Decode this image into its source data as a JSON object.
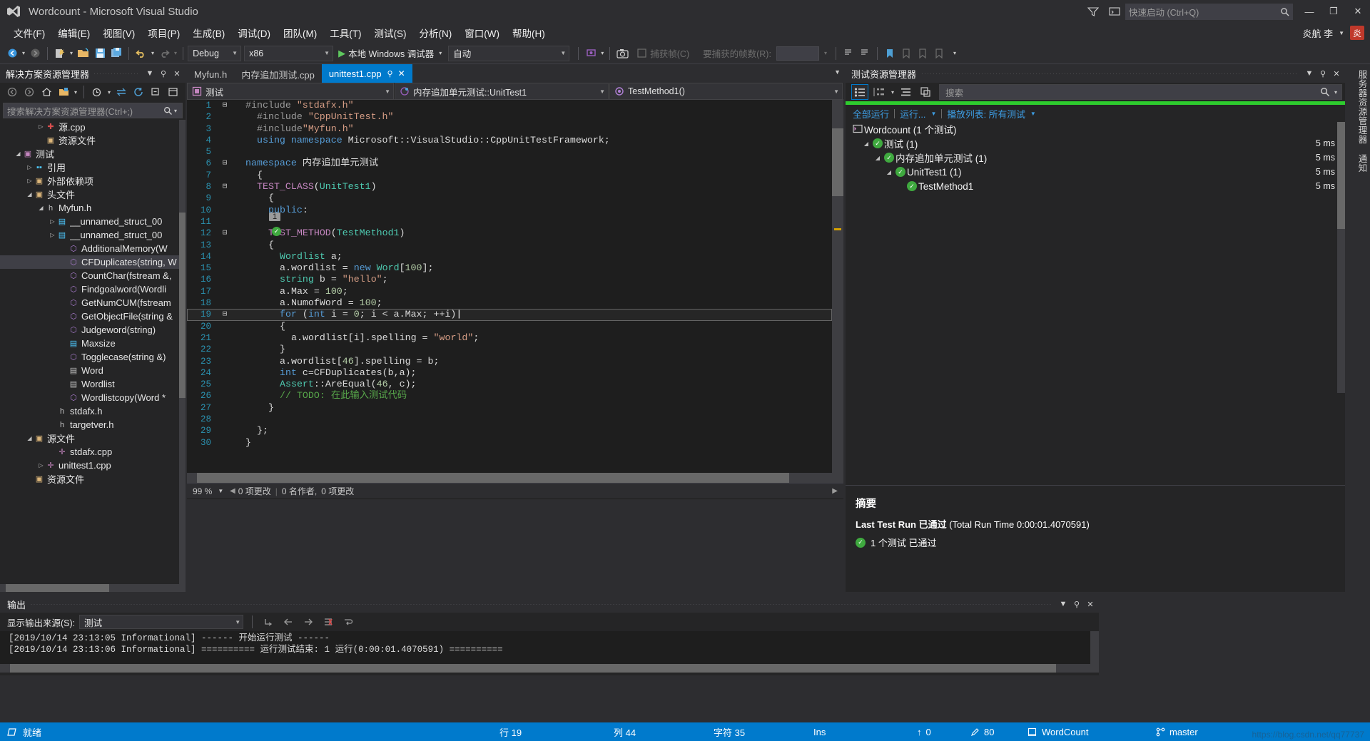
{
  "titlebar": {
    "title": "Wordcount - Microsoft Visual Studio",
    "quick_launch_placeholder": "快速启动 (Ctrl+Q)",
    "minimize": "—",
    "maximize": "❐",
    "close": "✕"
  },
  "menubar": {
    "items": [
      "文件(F)",
      "编辑(E)",
      "视图(V)",
      "项目(P)",
      "生成(B)",
      "调试(D)",
      "团队(M)",
      "工具(T)",
      "测试(S)",
      "分析(N)",
      "窗口(W)",
      "帮助(H)"
    ],
    "user_name": "炎航 李",
    "user_initial": "炎"
  },
  "toolbar": {
    "config": "Debug",
    "platform": "x86",
    "run_target": "本地 Windows 调试器",
    "auto": "自动",
    "capture_frame": "捕获帧(C)",
    "frames_label": "要捕获的帧数(R):",
    "frames_value": ""
  },
  "solution_explorer": {
    "title": "解决方案资源管理器",
    "search_placeholder": "搜索解决方案资源管理器(Ctrl+;)",
    "items": [
      {
        "label": "源.cpp",
        "indent": 3,
        "arrow": "▷",
        "icon": "cpp-error-icon",
        "color": "#d94f4f",
        "glyph": "✚"
      },
      {
        "label": "资源文件",
        "indent": 3,
        "arrow": "",
        "icon": "folder-icon",
        "color": "#dcb67a",
        "glyph": "▣"
      },
      {
        "label": "测试",
        "indent": 1,
        "arrow": "◢",
        "icon": "project-icon",
        "color": "#c586c0",
        "glyph": "▣"
      },
      {
        "label": "引用",
        "indent": 2,
        "arrow": "▷",
        "icon": "references-icon",
        "color": "#4ec9ff",
        "glyph": "▪▪"
      },
      {
        "label": "外部依赖项",
        "indent": 2,
        "arrow": "▷",
        "icon": "folder-icon",
        "color": "#dcb67a",
        "glyph": "▣"
      },
      {
        "label": "头文件",
        "indent": 2,
        "arrow": "◢",
        "icon": "folder-icon",
        "color": "#dcb67a",
        "glyph": "▣"
      },
      {
        "label": "Myfun.h",
        "indent": 3,
        "arrow": "◢",
        "icon": "header-file-icon",
        "color": "#c0c0c0",
        "glyph": "h"
      },
      {
        "label": "__unnamed_struct_00",
        "indent": 4,
        "arrow": "▷",
        "icon": "struct-icon",
        "color": "#4ec9ff",
        "glyph": "▤"
      },
      {
        "label": "__unnamed_struct_00",
        "indent": 4,
        "arrow": "▷",
        "icon": "struct-icon",
        "color": "#4ec9ff",
        "glyph": "▤"
      },
      {
        "label": "AdditionalMemory(W",
        "indent": 5,
        "arrow": "",
        "icon": "method-icon",
        "color": "#b180d7",
        "glyph": "⬡"
      },
      {
        "label": "CFDuplicates(string, W",
        "indent": 5,
        "arrow": "",
        "icon": "method-icon",
        "color": "#b180d7",
        "glyph": "⬡",
        "selected": true
      },
      {
        "label": "CountChar(fstream &,",
        "indent": 5,
        "arrow": "",
        "icon": "method-icon",
        "color": "#b180d7",
        "glyph": "⬡"
      },
      {
        "label": "Findgoalword(Wordli",
        "indent": 5,
        "arrow": "",
        "icon": "method-icon",
        "color": "#b180d7",
        "glyph": "⬡"
      },
      {
        "label": "GetNumCUM(fstream",
        "indent": 5,
        "arrow": "",
        "icon": "method-icon",
        "color": "#b180d7",
        "glyph": "⬡"
      },
      {
        "label": "GetObjectFile(string &",
        "indent": 5,
        "arrow": "",
        "icon": "method-icon",
        "color": "#b180d7",
        "glyph": "⬡"
      },
      {
        "label": "Judgeword(string)",
        "indent": 5,
        "arrow": "",
        "icon": "method-icon",
        "color": "#b180d7",
        "glyph": "⬡"
      },
      {
        "label": "Maxsize",
        "indent": 5,
        "arrow": "",
        "icon": "constant-icon",
        "color": "#4ec9ff",
        "glyph": "▤"
      },
      {
        "label": "Togglecase(string &)",
        "indent": 5,
        "arrow": "",
        "icon": "method-icon",
        "color": "#b180d7",
        "glyph": "⬡"
      },
      {
        "label": "Word",
        "indent": 5,
        "arrow": "",
        "icon": "class-icon",
        "color": "#c0c0c0",
        "glyph": "▤"
      },
      {
        "label": "Wordlist",
        "indent": 5,
        "arrow": "",
        "icon": "class-icon",
        "color": "#c0c0c0",
        "glyph": "▤"
      },
      {
        "label": "Wordlistcopy(Word *",
        "indent": 5,
        "arrow": "",
        "icon": "method-icon",
        "color": "#b180d7",
        "glyph": "⬡"
      },
      {
        "label": "stdafx.h",
        "indent": 4,
        "arrow": "",
        "icon": "header-file-icon",
        "color": "#c0c0c0",
        "glyph": "h"
      },
      {
        "label": "targetver.h",
        "indent": 4,
        "arrow": "",
        "icon": "header-file-icon",
        "color": "#c0c0c0",
        "glyph": "h"
      },
      {
        "label": "源文件",
        "indent": 2,
        "arrow": "◢",
        "icon": "folder-icon",
        "color": "#dcb67a",
        "glyph": "▣"
      },
      {
        "label": "stdafx.cpp",
        "indent": 4,
        "arrow": "",
        "icon": "cpp-file-icon",
        "color": "#c586c0",
        "glyph": "✛"
      },
      {
        "label": "unittest1.cpp",
        "indent": 3,
        "arrow": "▷",
        "icon": "cpp-file-icon",
        "color": "#c586c0",
        "glyph": "✛"
      },
      {
        "label": "资源文件",
        "indent": 2,
        "arrow": "",
        "icon": "folder-icon",
        "color": "#dcb67a",
        "glyph": "▣"
      }
    ]
  },
  "editor": {
    "tabs": [
      {
        "label": "Myfun.h",
        "active": false
      },
      {
        "label": "内存追加测试.cpp",
        "active": false
      },
      {
        "label": "unittest1.cpp",
        "active": true,
        "pin": "⚲",
        "close": "✕"
      }
    ],
    "nav": {
      "project": "测试",
      "scope": "内存追加单元测试::UnitTest1",
      "member": "TestMethod1()"
    },
    "code_coverage_badge": "1",
    "zoom": "99 %",
    "status_changes": "0 项更改",
    "status_authors": "0 名作者,",
    "status_changes2": "0 项更改",
    "lines": [
      {
        "num": 1,
        "fold": "⊟",
        "text": "#include \"stdafx.h\"",
        "tokens": [
          [
            "pp",
            "#include "
          ],
          [
            "s",
            "\"stdafx.h\""
          ]
        ]
      },
      {
        "num": 2,
        "fold": "",
        "text": "#include \"CppUnitTest.h\"",
        "tokens": [
          [
            "pp",
            "#include "
          ],
          [
            "s",
            "\"CppUnitTest.h\""
          ]
        ]
      },
      {
        "num": 3,
        "fold": "",
        "text": "#include\"Myfun.h\"",
        "tokens": [
          [
            "pp",
            "#include"
          ],
          [
            "s",
            "\"Myfun.h\""
          ]
        ]
      },
      {
        "num": 4,
        "fold": "",
        "text": "using namespace Microsoft::VisualStudio::CppUnitTestFramework;",
        "tokens": [
          [
            "k",
            "using namespace "
          ],
          [
            "p",
            "Microsoft"
          ],
          [
            "p",
            "::"
          ],
          [
            "p",
            "VisualStudio"
          ],
          [
            "p",
            "::"
          ],
          [
            "p",
            "CppUnitTestFramework;"
          ]
        ]
      },
      {
        "num": 5,
        "fold": "",
        "text": "",
        "tokens": []
      },
      {
        "num": 6,
        "fold": "⊟",
        "text": "namespace 内存追加单元测试",
        "tokens": [
          [
            "k",
            "namespace "
          ],
          [
            "p",
            "内存追加单元测试"
          ]
        ]
      },
      {
        "num": 7,
        "fold": "",
        "text": "{",
        "tokens": [
          [
            "p",
            "{"
          ]
        ]
      },
      {
        "num": 8,
        "fold": "⊟",
        "text": "TEST_CLASS(UnitTest1)",
        "tokens": [
          [
            "m",
            "TEST_CLASS"
          ],
          [
            "p",
            "("
          ],
          [
            "t",
            "UnitTest1"
          ],
          [
            "p",
            ")"
          ]
        ]
      },
      {
        "num": 9,
        "fold": "",
        "text": "{",
        "tokens": [
          [
            "p",
            "{"
          ]
        ]
      },
      {
        "num": 10,
        "fold": "",
        "text": "public:",
        "tokens": [
          [
            "k",
            "public"
          ],
          [
            "p",
            ":"
          ]
        ]
      },
      {
        "num": 11,
        "fold": "",
        "text": "",
        "tokens": []
      },
      {
        "num": 12,
        "fold": "⊟",
        "text": "TEST_METHOD(TestMethod1)",
        "tokens": [
          [
            "m",
            "TEST_METHOD"
          ],
          [
            "p",
            "("
          ],
          [
            "t",
            "TestMethod1"
          ],
          [
            "p",
            ")"
          ]
        ]
      },
      {
        "num": 13,
        "fold": "",
        "text": "{",
        "tokens": [
          [
            "p",
            "{"
          ]
        ]
      },
      {
        "num": 14,
        "fold": "",
        "text": "Wordlist a;",
        "tokens": [
          [
            "t",
            "Wordlist"
          ],
          [
            "p",
            " a;"
          ]
        ]
      },
      {
        "num": 15,
        "fold": "",
        "text": "a.wordlist = new Word[100];",
        "tokens": [
          [
            "p",
            "a.wordlist = "
          ],
          [
            "k",
            "new "
          ],
          [
            "t",
            "Word"
          ],
          [
            "p",
            "["
          ],
          [
            "n",
            "100"
          ],
          [
            "p",
            "];"
          ]
        ]
      },
      {
        "num": 16,
        "fold": "",
        "text": "string b = \"hello\";",
        "tokens": [
          [
            "t",
            "string"
          ],
          [
            "p",
            " b = "
          ],
          [
            "s",
            "\"hello\""
          ],
          [
            "p",
            ";"
          ]
        ]
      },
      {
        "num": 17,
        "fold": "",
        "text": "a.Max = 100;",
        "tokens": [
          [
            "p",
            "a.Max = "
          ],
          [
            "n",
            "100"
          ],
          [
            "p",
            ";"
          ]
        ],
        "changed": true
      },
      {
        "num": 18,
        "fold": "",
        "text": "a.NumofWord = 100;",
        "tokens": [
          [
            "p",
            "a.NumofWord = "
          ],
          [
            "n",
            "100"
          ],
          [
            "p",
            ";"
          ]
        ],
        "changed": true
      },
      {
        "num": 19,
        "fold": "⊟",
        "text": "for (int i = 0; i < a.Max; ++i)",
        "tokens": [
          [
            "k",
            "for"
          ],
          [
            "p",
            " ("
          ],
          [
            "k",
            "int"
          ],
          [
            "p",
            " i = "
          ],
          [
            "n",
            "0"
          ],
          [
            "p",
            "; i < a.Max; ++i)"
          ]
        ],
        "current": true
      },
      {
        "num": 20,
        "fold": "",
        "text": "{",
        "tokens": [
          [
            "p",
            "{"
          ]
        ]
      },
      {
        "num": 21,
        "fold": "",
        "text": "a.wordlist[i].spelling = \"world\";",
        "tokens": [
          [
            "p",
            "a.wordlist[i].spelling = "
          ],
          [
            "s",
            "\"world\""
          ],
          [
            "p",
            ";"
          ]
        ]
      },
      {
        "num": 22,
        "fold": "",
        "text": "}",
        "tokens": [
          [
            "p",
            "}"
          ]
        ]
      },
      {
        "num": 23,
        "fold": "",
        "text": "a.wordlist[46].spelling = b;",
        "tokens": [
          [
            "p",
            "a.wordlist["
          ],
          [
            "n",
            "46"
          ],
          [
            "p",
            "].spelling = b;"
          ]
        ]
      },
      {
        "num": 24,
        "fold": "",
        "text": "int c=CFDuplicates(b,a);",
        "tokens": [
          [
            "k",
            "int"
          ],
          [
            "p",
            " c=CFDuplicates(b,a);"
          ]
        ]
      },
      {
        "num": 25,
        "fold": "",
        "text": "Assert::AreEqual(46, c);",
        "tokens": [
          [
            "t",
            "Assert"
          ],
          [
            "p",
            "::AreEqual("
          ],
          [
            "n",
            "46"
          ],
          [
            "p",
            ", c);"
          ]
        ]
      },
      {
        "num": 26,
        "fold": "",
        "text": "// TODO: 在此输入测试代码",
        "tokens": [
          [
            "g",
            "// TODO: 在此输入测试代码"
          ]
        ]
      },
      {
        "num": 27,
        "fold": "",
        "text": "}",
        "tokens": [
          [
            "p",
            "}"
          ]
        ]
      },
      {
        "num": 28,
        "fold": "",
        "text": "",
        "tokens": []
      },
      {
        "num": 29,
        "fold": "",
        "text": "};",
        "tokens": [
          [
            "p",
            "};"
          ]
        ]
      },
      {
        "num": 30,
        "fold": "",
        "text": "}",
        "tokens": [
          [
            "p",
            "}"
          ]
        ]
      }
    ],
    "indent_map": [
      1,
      2,
      2,
      2,
      0,
      1,
      2,
      2,
      3,
      3,
      0,
      3,
      3,
      4,
      4,
      4,
      4,
      4,
      4,
      4,
      5,
      4,
      4,
      4,
      4,
      4,
      3,
      0,
      2,
      1
    ]
  },
  "output": {
    "title": "输出",
    "source_label": "显示输出来源(S):",
    "source_value": "测试",
    "lines": [
      "[2019/10/14 23:13:05 Informational] ------ 开始运行测试 ------",
      "[2019/10/14 23:13:06 Informational] ========== 运行测试结束: 1 运行(0:00:01.4070591) =========="
    ]
  },
  "test_explorer": {
    "title": "测试资源管理器",
    "search_placeholder": "搜索",
    "actions": {
      "run_all": "全部运行",
      "run": "运行...",
      "playlist": "播放列表: 所有测试"
    },
    "root": "Wordcount (1 个测试)",
    "rows": [
      {
        "label": "测试 (1)",
        "duration": "5 ms",
        "indent": 1,
        "arrow": "◢",
        "status": "passed"
      },
      {
        "label": "内存追加单元测试 (1)",
        "duration": "5 ms",
        "indent": 2,
        "arrow": "◢",
        "status": "passed"
      },
      {
        "label": "UnitTest1 (1)",
        "duration": "5 ms",
        "indent": 3,
        "arrow": "◢",
        "status": "passed"
      },
      {
        "label": "TestMethod1",
        "duration": "5 ms",
        "indent": 4,
        "arrow": "",
        "status": "passed"
      }
    ],
    "summary": {
      "title": "摘要",
      "headline_bold": "Last Test Run 已通过",
      "headline_rest": " (Total Run Time 0:00:01.4070591)",
      "detail": "1 个测试 已通过"
    }
  },
  "right_tabs": [
    "服务器资源管理器",
    "通知"
  ],
  "statusbar": {
    "ready": "就绪",
    "line_label": "行 19",
    "col_label": "列 44",
    "char_label": "字符 35",
    "ins_label": "Ins",
    "up_count": "0",
    "pen_count": "80",
    "repo": "WordCount",
    "branch": "master",
    "watermark": "https://blog.csdn.net/qq77737"
  }
}
